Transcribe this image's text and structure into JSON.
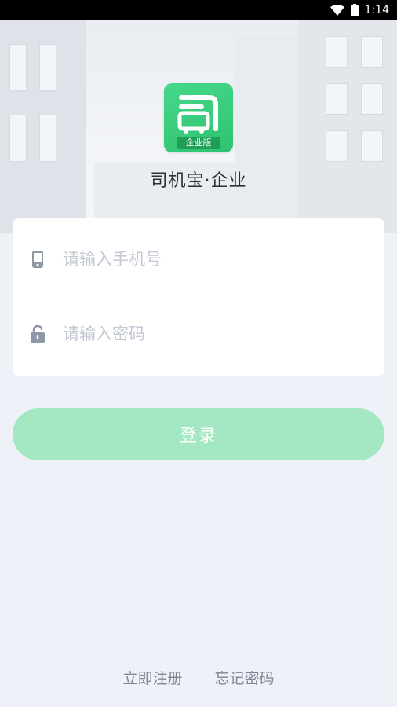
{
  "status_bar": {
    "time": "1:14",
    "wifi_icon": "wifi-icon",
    "battery_icon": "battery-icon"
  },
  "app": {
    "logo_icon": "app-logo-icon",
    "logo_badge": "企业版",
    "title": "司机宝·企业",
    "brand_color": "#36c97b"
  },
  "form": {
    "phone": {
      "icon": "phone-icon",
      "placeholder": "请输入手机号",
      "value": ""
    },
    "password": {
      "icon": "unlock-icon",
      "placeholder": "请输入密码",
      "value": ""
    }
  },
  "login_button": {
    "label": "登录",
    "color": "#a3e8c2"
  },
  "footer": {
    "register_label": "立即注册",
    "forgot_label": "忘记密码"
  }
}
